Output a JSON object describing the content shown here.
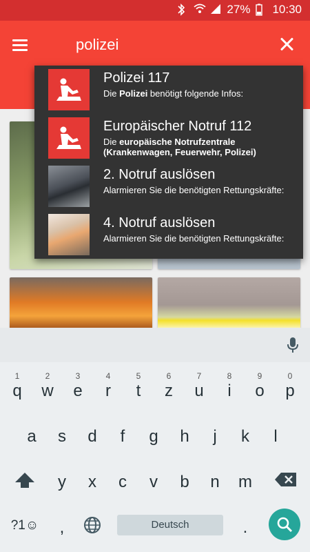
{
  "status_bar": {
    "battery": "27%",
    "time": "10:30",
    "icons": [
      "bluetooth-icon",
      "wifi-icon",
      "signal-icon",
      "battery-icon"
    ]
  },
  "app_bar": {
    "query": "polizei",
    "menu_icon": "hamburger-menu-icon",
    "clear_icon": "close-icon"
  },
  "suggestions": [
    {
      "title": "Polizei 117",
      "subtitle_parts": [
        "Die ",
        "Polizei",
        " benötigt folgende Infos:"
      ],
      "thumb": "cpr-icon"
    },
    {
      "title": "Europäischer Notruf 112",
      "subtitle_parts": [
        "Die ",
        "europäische Notrufzentrale (Krankenwagen, Feuerwehr, Polizei)",
        ""
      ],
      "thumb": "cpr-icon"
    },
    {
      "title": "2. Notruf auslösen",
      "subtitle": "Alarmieren Sie die benötigten Rettungskräfte:",
      "thumb": "crashed-car-photo"
    },
    {
      "title": "4. Notruf auslösen",
      "subtitle": "Alarmieren Sie die benötigten Rettungskräfte:",
      "thumb": "person-photo"
    }
  ],
  "keyboard": {
    "row1": [
      {
        "key": "q",
        "sup": "1"
      },
      {
        "key": "w",
        "sup": "2"
      },
      {
        "key": "e",
        "sup": "3"
      },
      {
        "key": "r",
        "sup": "4"
      },
      {
        "key": "t",
        "sup": "5"
      },
      {
        "key": "z",
        "sup": "6"
      },
      {
        "key": "u",
        "sup": "7"
      },
      {
        "key": "i",
        "sup": "8"
      },
      {
        "key": "o",
        "sup": "9"
      },
      {
        "key": "p",
        "sup": "0"
      }
    ],
    "row2": [
      "a",
      "s",
      "d",
      "f",
      "g",
      "h",
      "j",
      "k",
      "l"
    ],
    "row3": [
      "y",
      "x",
      "c",
      "v",
      "b",
      "n",
      "m"
    ],
    "symbols_label": "?1☺",
    "comma": ",",
    "space_label": "Deutsch",
    "period": "."
  },
  "colors": {
    "status_bar": "#d32f2f",
    "app_bar": "#f44336",
    "dropdown": "#333333",
    "search_key": "#26a69a"
  }
}
